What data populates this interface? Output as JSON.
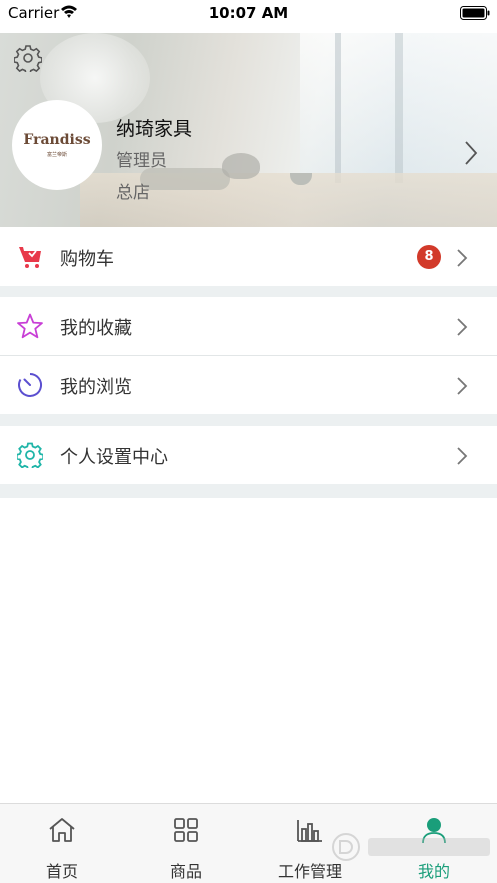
{
  "status_bar": {
    "carrier": "Carrier",
    "time": "10:07 AM"
  },
  "profile": {
    "name": "纳琦家具",
    "role": "管理员",
    "store": "总店",
    "avatar_brand": "Frandiss",
    "avatar_sub": "富兰帝斯"
  },
  "menu": {
    "cart": {
      "label": "购物车",
      "badge": "8",
      "icon": "cart-icon"
    },
    "favorites": {
      "label": "我的收藏",
      "icon": "star-icon"
    },
    "history": {
      "label": "我的浏览",
      "icon": "timer-icon"
    },
    "settings": {
      "label": "个人设置中心",
      "icon": "gear-icon"
    }
  },
  "tabbar": {
    "items": [
      {
        "label": "首页",
        "icon": "home-icon"
      },
      {
        "label": "商品",
        "icon": "grid-icon"
      },
      {
        "label": "工作管理",
        "icon": "bar-chart-icon"
      },
      {
        "label": "我的",
        "icon": "user-icon"
      }
    ],
    "active_index": 3
  },
  "colors": {
    "accent": "#1a9e7a",
    "badge": "#d23a2a",
    "cart_icon": "#e8394a",
    "star_icon": "#c83fd6",
    "timer_icon": "#5b4fd0",
    "gear_icon": "#1fb5a8",
    "section_gap": "#ecf0f1"
  }
}
